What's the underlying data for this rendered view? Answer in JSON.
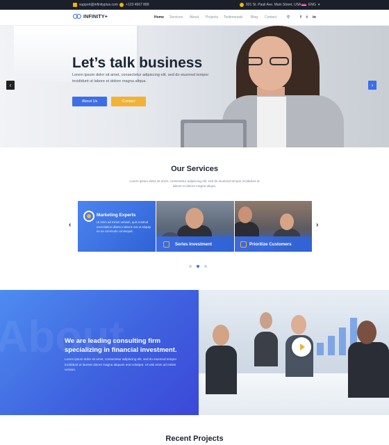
{
  "topbar": {
    "email": "support@infinityplus.com",
    "phone": "+123 4567 889",
    "address": "921 St. Pauli Ave. Main Street, USA",
    "language": "ENG"
  },
  "nav": {
    "logo_text": "INFINITY+",
    "items": [
      {
        "label": "Home",
        "active": true
      },
      {
        "label": "Services"
      },
      {
        "label": "About"
      },
      {
        "label": "Projects"
      },
      {
        "label": "Testimonials"
      },
      {
        "label": "Blog"
      },
      {
        "label": "Contact"
      }
    ],
    "social": [
      "f",
      "t",
      "in"
    ]
  },
  "hero": {
    "title": "Let’s talk business",
    "text": "Lorem ipsum dolor sit amet, consectetur adipiscing elit, sed do eiusmod tempor incididunt ut labore et dolore magna aliqua.",
    "btn_primary": "About Us",
    "btn_secondary": "Contact",
    "arrow_left": "‹",
    "arrow_right": "›"
  },
  "services": {
    "title": "Our Services",
    "subtitle": "Lorem ipsum dolor sit amet, consectetur adipiscing elit, sed do eiusmod tempor incididunt ut labore et dolore magna aliqua.",
    "cards": [
      {
        "title": "Marketing Experts",
        "text": "Ut enim ad minim veniam, quis nostrud exercitation ullamco laboris nisi ut aliquip ex ea commodo consequat."
      },
      {
        "title": "Series Investment"
      },
      {
        "title": "Prioritize Customers"
      }
    ],
    "prev": "‹",
    "next": "›",
    "active_dot": 1
  },
  "about": {
    "watermark": "About",
    "heading": "We are leading consulting firm specializing in financial investment.",
    "text": "Lorem ipsum dolor sit amet, consectetur adipiscing elit, sed do eiusmod tempor incididunt ut laoreet dolore magna aliquam erat volutpat. Ut wisi enim ad minim veniam."
  },
  "recent": {
    "title": "Recent Projects"
  },
  "colors": {
    "accent": "#3c6ee8",
    "highlight": "#f2b233",
    "dark": "#1b1f2a"
  }
}
